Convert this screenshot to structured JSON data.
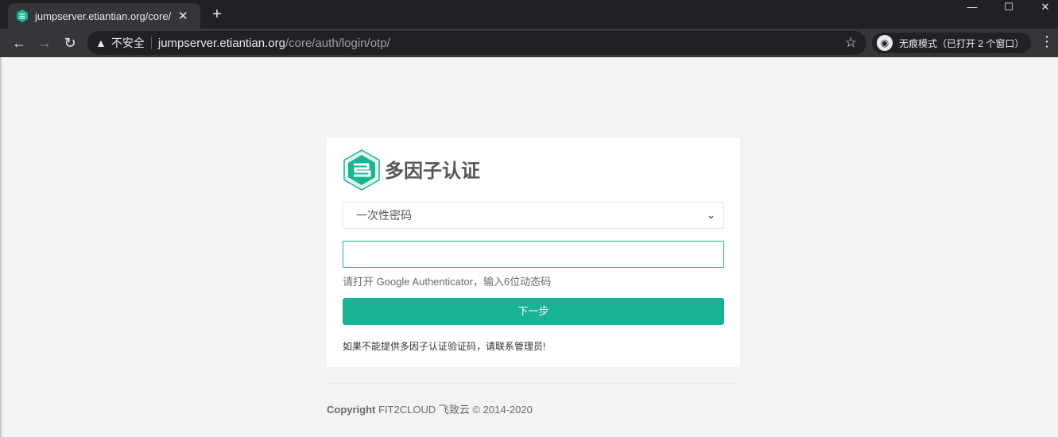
{
  "browser": {
    "tab_title": "jumpserver.etiantian.org/core/",
    "new_tab_label": "+",
    "url_warning": "不安全",
    "url_host": "jumpserver.etiantian.org",
    "url_path": "/core/auth/login/otp/",
    "incognito_label": "无痕模式（已打开 2 个窗口）"
  },
  "card": {
    "title": "多因子认证",
    "select_value": "一次性密码",
    "input_value": "",
    "help_text": "请打开 Google Authenticator，输入6位动态码",
    "next_button": "下一步",
    "contact_text": "如果不能提供多因子认证验证码，请联系管理员!"
  },
  "footer": {
    "copyright_label": "Copyright",
    "copyright_text": " FIT2CLOUD 飞致云 © 2014-2020"
  },
  "colors": {
    "accent": "#1ab394",
    "chrome_dark": "#202124",
    "chrome_toolbar": "#35363a"
  }
}
